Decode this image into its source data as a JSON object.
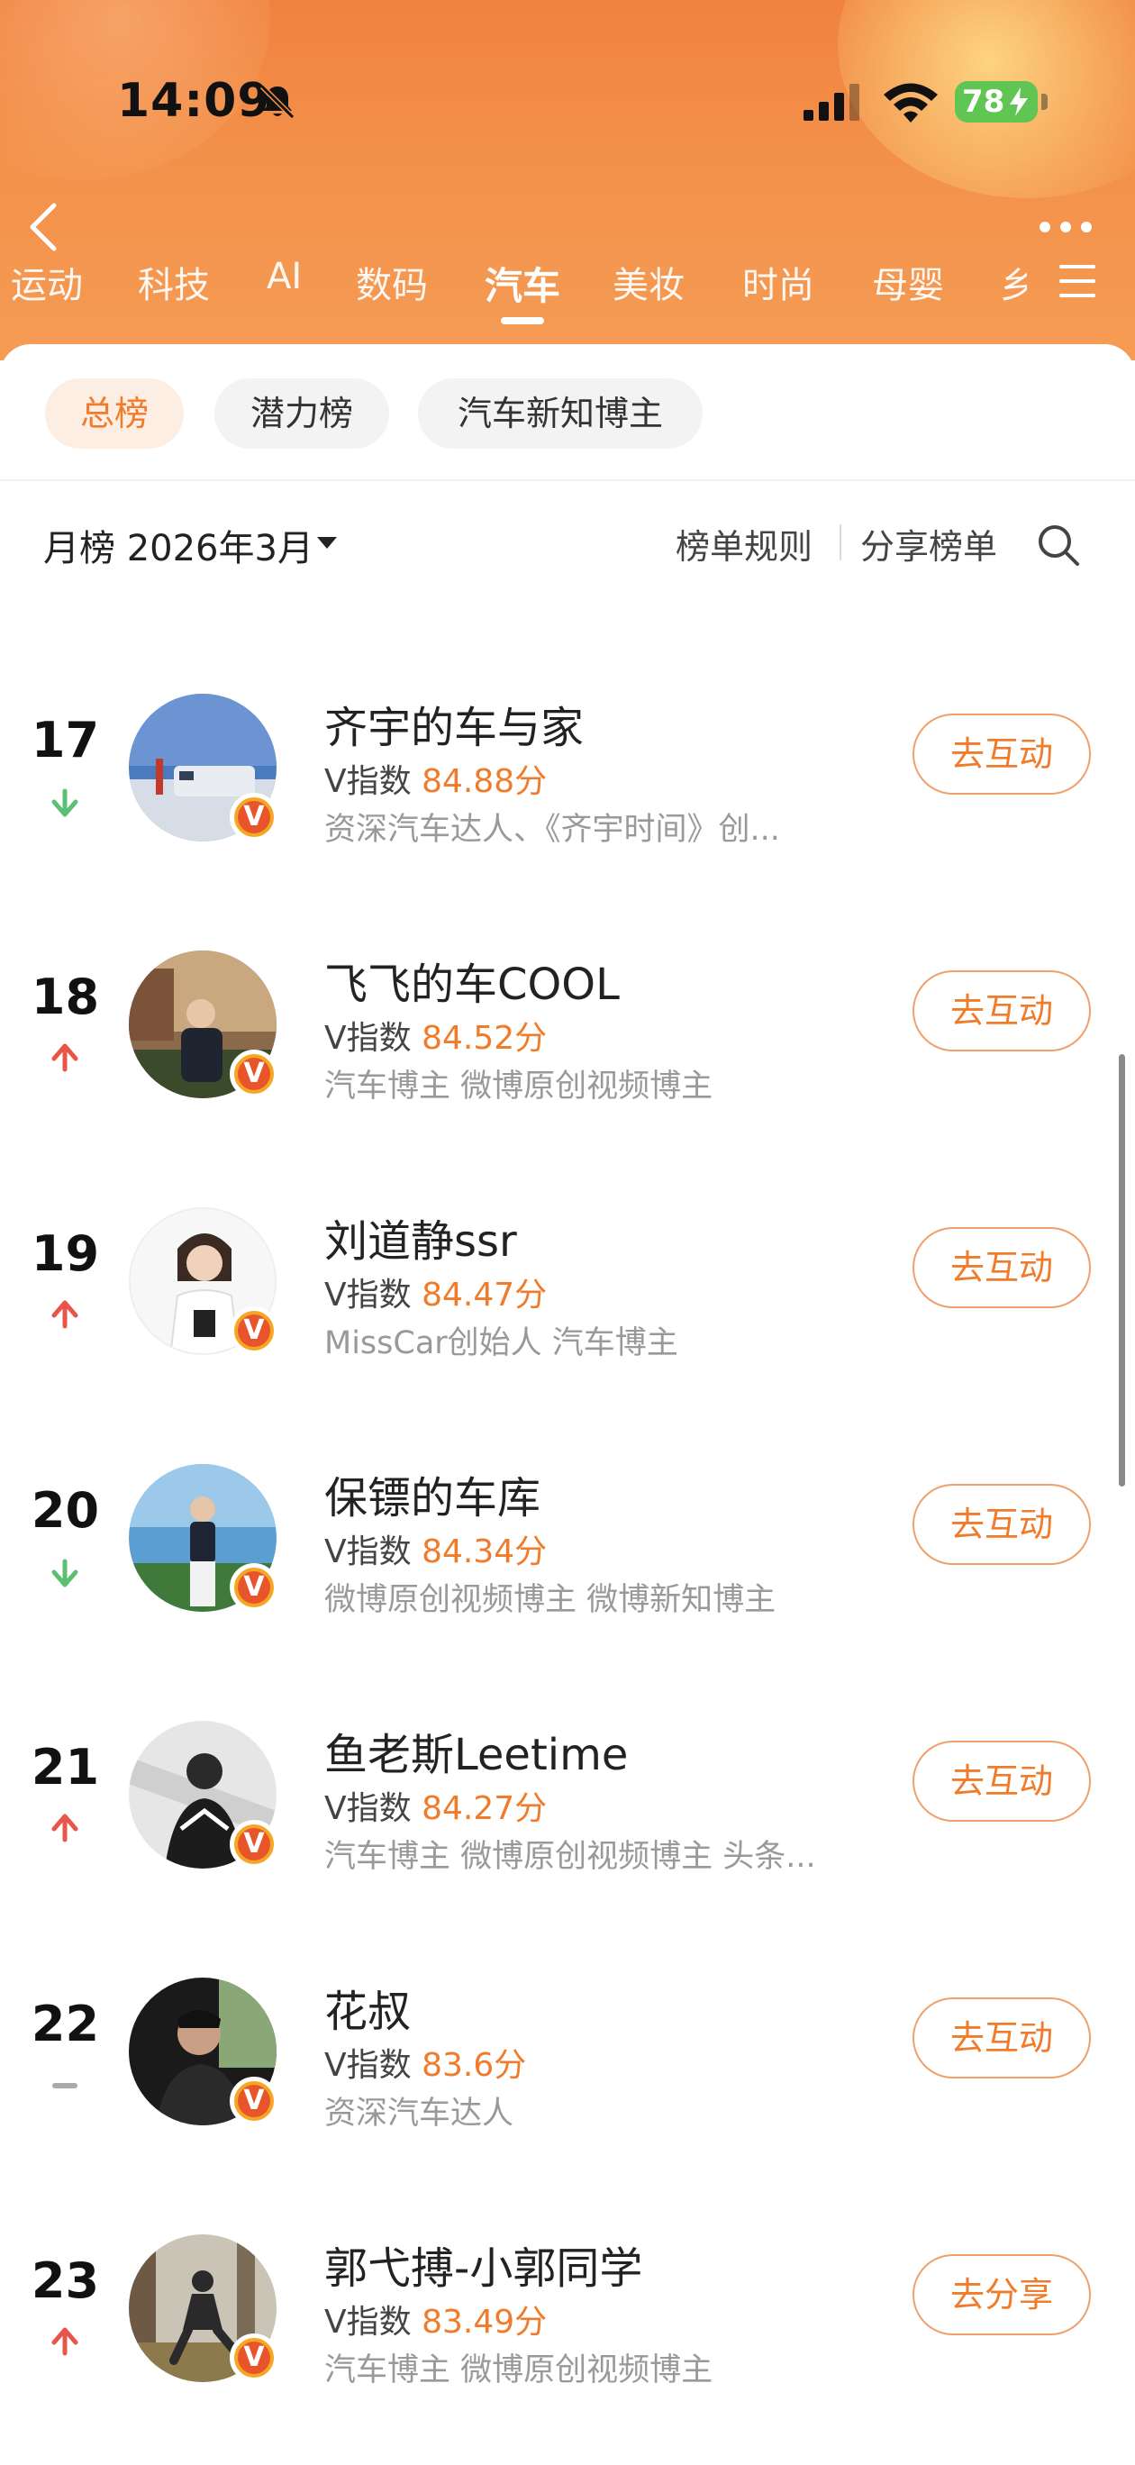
{
  "status": {
    "time": "14:09",
    "battery": "78"
  },
  "tabs": [
    {
      "label": "运动"
    },
    {
      "label": "科技"
    },
    {
      "label": "AI"
    },
    {
      "label": "数码"
    },
    {
      "label": "汽车",
      "active": true
    },
    {
      "label": "美妆"
    },
    {
      "label": "时尚"
    },
    {
      "label": "母婴"
    },
    {
      "label": "乡"
    }
  ],
  "filters": [
    {
      "label": "总榜",
      "active": true
    },
    {
      "label": "潜力榜"
    },
    {
      "label": "汽车新知博主"
    }
  ],
  "toolbar": {
    "month": "月榜 2026年3月",
    "rules": "榜单规则",
    "share": "分享榜单"
  },
  "rankings": [
    {
      "rank": "17",
      "trend": "down",
      "name": "齐宇的车与家",
      "v_label": "V指数",
      "score": "84.88分",
      "desc": "资深汽车达人、《齐宇时间》创...",
      "action": "去互动"
    },
    {
      "rank": "18",
      "trend": "up",
      "name": "飞飞的车COOL",
      "v_label": "V指数",
      "score": "84.52分",
      "desc": "汽车博主 微博原创视频博主",
      "action": "去互动"
    },
    {
      "rank": "19",
      "trend": "up",
      "name": "刘道静ssr",
      "v_label": "V指数",
      "score": "84.47分",
      "desc": "MissCar创始人 汽车博主",
      "action": "去互动"
    },
    {
      "rank": "20",
      "trend": "down",
      "name": "保镖的车库",
      "v_label": "V指数",
      "score": "84.34分",
      "desc": "微博原创视频博主 微博新知博主",
      "action": "去互动"
    },
    {
      "rank": "21",
      "trend": "up",
      "name": "鱼老斯Leetime",
      "v_label": "V指数",
      "score": "84.27分",
      "desc": "汽车博主 微博原创视频博主 头条...",
      "action": "去互动"
    },
    {
      "rank": "22",
      "trend": "same",
      "name": "花叔",
      "v_label": "V指数",
      "score": "83.6分",
      "desc": "资深汽车达人",
      "action": "去互动"
    },
    {
      "rank": "23",
      "trend": "up",
      "name": "郭弋搏-小郭同学",
      "v_label": "V指数",
      "score": "83.49分",
      "desc": "汽车博主 微博原创视频博主",
      "action": "去分享"
    }
  ],
  "colors": {
    "accent": "#f07b2a",
    "up": "#e8554a",
    "down": "#5cbf73",
    "header": "#f3914a"
  }
}
